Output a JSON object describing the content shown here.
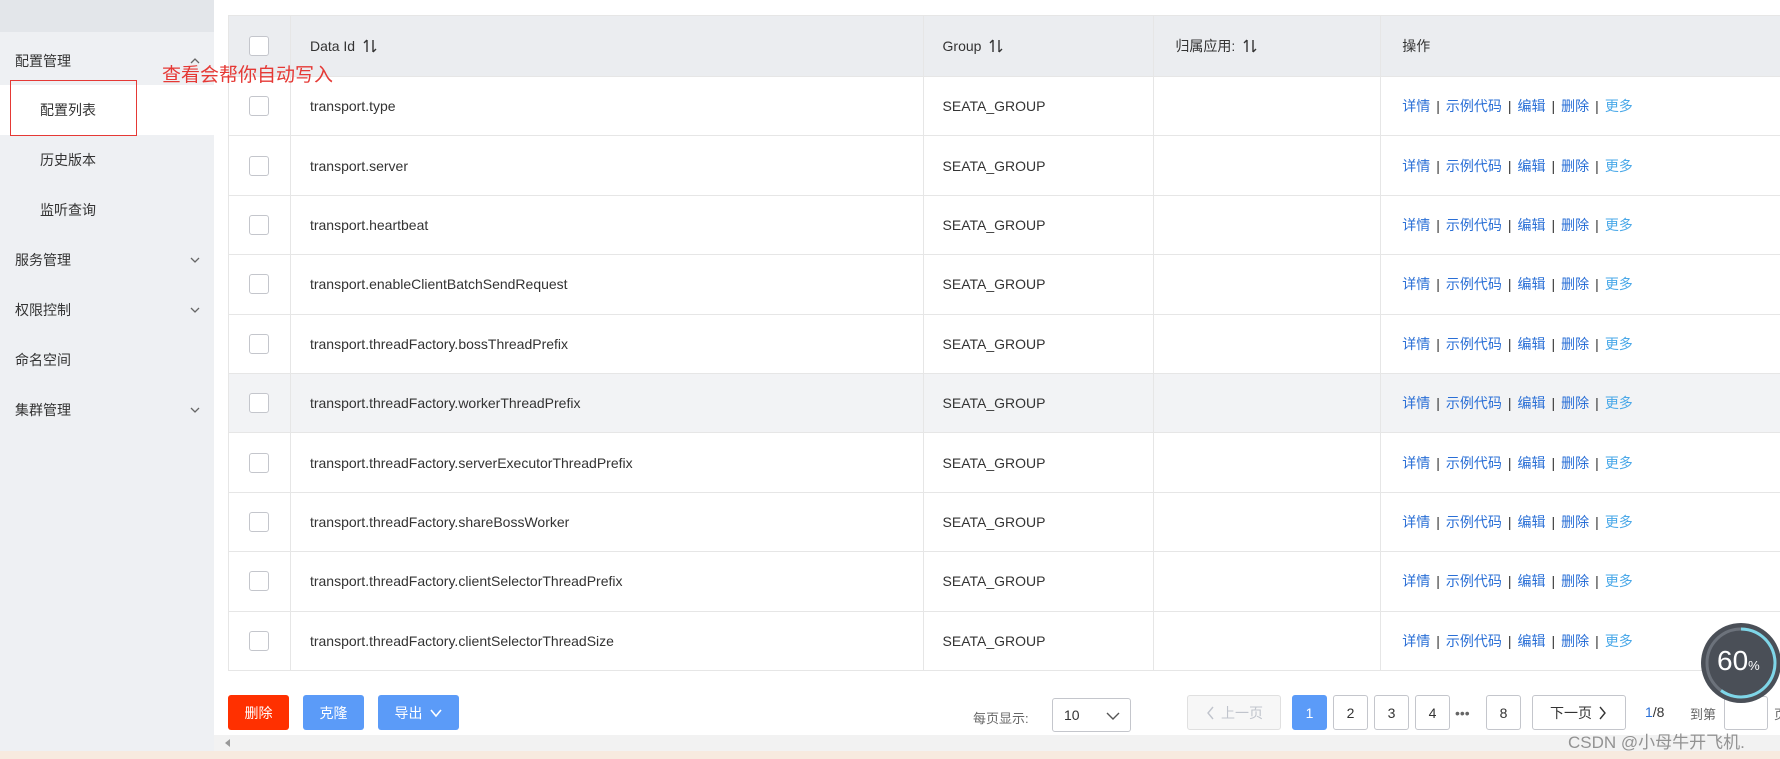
{
  "sidebar": {
    "menu": [
      {
        "label": "配置管理"
      },
      {
        "label": "服务管理"
      },
      {
        "label": "权限控制"
      },
      {
        "label": "命名空间"
      },
      {
        "label": "集群管理"
      }
    ],
    "submenu": [
      {
        "label": "配置列表",
        "active": true
      },
      {
        "label": "历史版本"
      },
      {
        "label": "监听查询"
      }
    ]
  },
  "annotation": "查看会帮你自动写入",
  "table": {
    "headers": {
      "data_id": "Data Id",
      "group": "Group",
      "app": "归属应用:",
      "ops": "操作"
    },
    "rows": [
      {
        "data_id": "transport.type",
        "group": "SEATA_GROUP",
        "app": ""
      },
      {
        "data_id": "transport.server",
        "group": "SEATA_GROUP",
        "app": ""
      },
      {
        "data_id": "transport.heartbeat",
        "group": "SEATA_GROUP",
        "app": ""
      },
      {
        "data_id": "transport.enableClientBatchSendRequest",
        "group": "SEATA_GROUP",
        "app": ""
      },
      {
        "data_id": "transport.threadFactory.bossThreadPrefix",
        "group": "SEATA_GROUP",
        "app": ""
      },
      {
        "data_id": "transport.threadFactory.workerThreadPrefix",
        "group": "SEATA_GROUP",
        "app": ""
      },
      {
        "data_id": "transport.threadFactory.serverExecutorThreadPrefix",
        "group": "SEATA_GROUP",
        "app": ""
      },
      {
        "data_id": "transport.threadFactory.shareBossWorker",
        "group": "SEATA_GROUP",
        "app": ""
      },
      {
        "data_id": "transport.threadFactory.clientSelectorThreadPrefix",
        "group": "SEATA_GROUP",
        "app": ""
      },
      {
        "data_id": "transport.threadFactory.clientSelectorThreadSize",
        "group": "SEATA_GROUP",
        "app": ""
      }
    ],
    "ops": {
      "detail": "详情",
      "sample_code": "示例代码",
      "edit": "编辑",
      "delete": "删除",
      "more": "更多",
      "separator": "|"
    }
  },
  "footer": {
    "delete_label": "删除",
    "clone_label": "克隆",
    "export_label": "导出",
    "per_page_label": "每页显示:",
    "per_page_value": "10",
    "prev_label": "上一页",
    "pages": [
      "1",
      "2",
      "3",
      "4"
    ],
    "dots": "•••",
    "last_page": "8",
    "next_label": "下一页",
    "page_current": "1",
    "page_total": "/8",
    "goto_label": "到第",
    "page_suffix": "页"
  },
  "widget": {
    "progress_percent": 60,
    "progress_value": "60",
    "progress_unit": "%"
  },
  "watermark": "CSDN @小母牛开飞机.",
  "colors": {
    "primary": "#5b9bf8",
    "danger": "#ff3000",
    "link": "#2a6fd6",
    "more_link": "#4aa8e8",
    "annotation": "#e53935"
  }
}
